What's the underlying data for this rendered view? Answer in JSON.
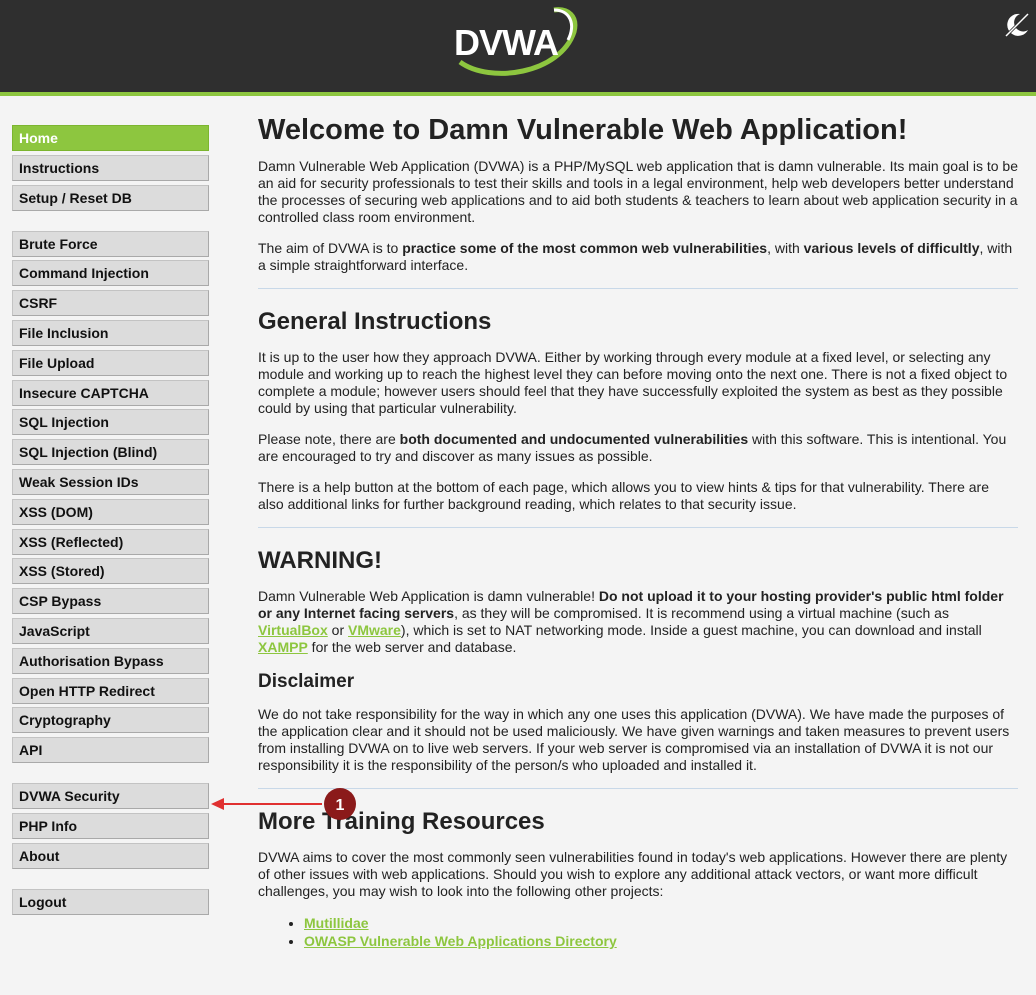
{
  "header": {
    "logo_text": "DVWA",
    "theme_toggle_icon": "theme-toggle-icon",
    "background_color": "#2f2f2f",
    "accent_color": "#8dc63f"
  },
  "menu": {
    "group1": [
      "Home",
      "Instructions",
      "Setup / Reset DB"
    ],
    "group2": [
      "Brute Force",
      "Command Injection",
      "CSRF",
      "File Inclusion",
      "File Upload",
      "Insecure CAPTCHA",
      "SQL Injection",
      "SQL Injection (Blind)",
      "Weak Session IDs",
      "XSS (DOM)",
      "XSS (Reflected)",
      "XSS (Stored)",
      "CSP Bypass",
      "JavaScript",
      "Authorisation Bypass",
      "Open HTTP Redirect",
      "Cryptography",
      "API"
    ],
    "group3": [
      "DVWA Security",
      "PHP Info",
      "About"
    ],
    "group4": [
      "Logout"
    ],
    "active": "Home"
  },
  "main": {
    "title": "Welcome to Damn Vulnerable Web Application!",
    "intro": "Damn Vulnerable Web Application (DVWA) is a PHP/MySQL web application that is damn vulnerable. Its main goal is to be an aid for security professionals to test their skills and tools in a legal environment, help web developers better understand the processes of securing web applications and to aid both students & teachers to learn about web application security in a controlled class room environment.",
    "aim": {
      "t1": "The aim of DVWA is to ",
      "b1": "practice some of the most common web vulnerabilities",
      "t2": ", with ",
      "b2": "various levels of difficultly",
      "t3": ", with a simple straightforward interface."
    },
    "general_heading": "General Instructions",
    "general_p1": "It is up to the user how they approach DVWA. Either by working through every module at a fixed level, or selecting any module and working up to reach the highest level they can before moving onto the next one. There is not a fixed object to complete a module; however users should feel that they have successfully exploited the system as best as they possible could by using that particular vulnerability.",
    "general_p2": {
      "t1": "Please note, there are ",
      "b1": "both documented and undocumented vulnerabilities",
      "t2": " with this software. This is intentional. You are encouraged to try and discover as many issues as possible."
    },
    "general_p3": "There is a help button at the bottom of each page, which allows you to view hints & tips for that vulnerability. There are also additional links for further background reading, which relates to that security issue.",
    "warning_heading": "WARNING!",
    "warning": {
      "t1": "Damn Vulnerable Web Application is damn vulnerable! ",
      "b1": "Do not upload it to your hosting provider's public html folder or any Internet facing servers",
      "t2": ", as they will be compromised. It is recommend using a virtual machine (such as ",
      "link1": "VirtualBox",
      "t3": " or ",
      "link2": "VMware",
      "t4": "), which is set to NAT networking mode. Inside a guest machine, you can download and install ",
      "link3": "XAMPP",
      "t5": " for the web server and database."
    },
    "disclaimer_heading": "Disclaimer",
    "disclaimer": "We do not take responsibility for the way in which any one uses this application (DVWA). We have made the purposes of the application clear and it should not be used maliciously. We have given warnings and taken measures to prevent users from installing DVWA on to live web servers. If your web server is compromised via an installation of DVWA it is not our responsibility it is the responsibility of the person/s who uploaded and installed it.",
    "resources_heading": "More Training Resources",
    "resources_p": "DVWA aims to cover the most commonly seen vulnerabilities found in today's web applications. However there are plenty of other issues with web applications. Should you wish to explore any additional attack vectors, or want more difficult challenges, you may wish to look into the following other projects:",
    "resources_links": [
      "Mutillidae",
      "OWASP Vulnerable Web Applications Directory"
    ]
  },
  "annotation": {
    "step_number": "1",
    "color": "#8b1a1a",
    "arrow_color": "#e03030"
  }
}
